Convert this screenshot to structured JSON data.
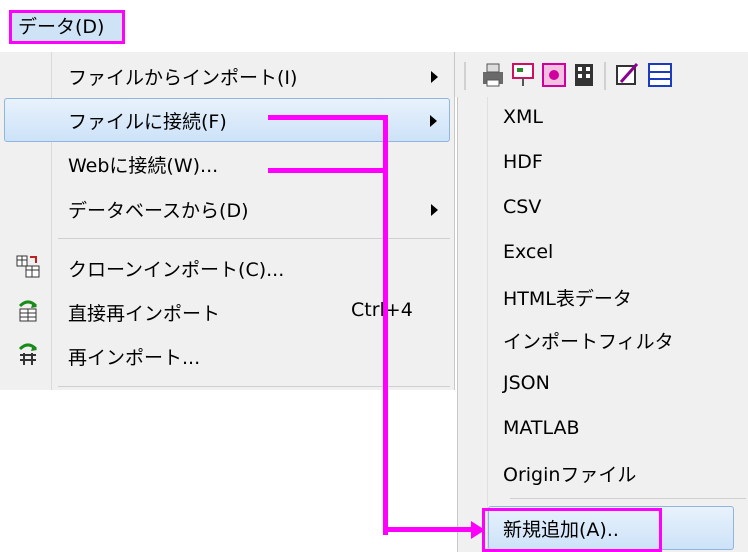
{
  "menubar": {
    "data_menu": "データ(D)"
  },
  "data_menu": {
    "items": [
      {
        "label": "ファイルからインポート(I)",
        "submenu": true
      },
      {
        "label": "ファイルに接続(F)",
        "submenu": true,
        "highlighted": true
      },
      {
        "label": "Webに接続(W)...",
        "submenu": false
      },
      {
        "label": "データベースから(D)",
        "submenu": true
      },
      {
        "label": "クローンインポート(C)...",
        "icon": "clone-import-icon"
      },
      {
        "label": "直接再インポート",
        "icon": "direct-reimport-icon",
        "shortcut": "Ctrl+4"
      },
      {
        "label": "再インポート...",
        "icon": "reimport-icon"
      }
    ]
  },
  "connect_submenu": {
    "items": [
      "XML",
      "HDF",
      "CSV",
      "Excel",
      "HTML表データ",
      "インポートフィルタ",
      "JSON",
      "MATLAB",
      "Originファイル"
    ],
    "new_add": "新規追加(A).."
  },
  "toolbar": {
    "icons": [
      "printer-icon",
      "presentation-icon",
      "record-icon",
      "film-icon",
      "edit-icon",
      "layout-icon"
    ]
  },
  "colors": {
    "annotation": "#ff00ff",
    "highlight": "#cde2f8"
  }
}
